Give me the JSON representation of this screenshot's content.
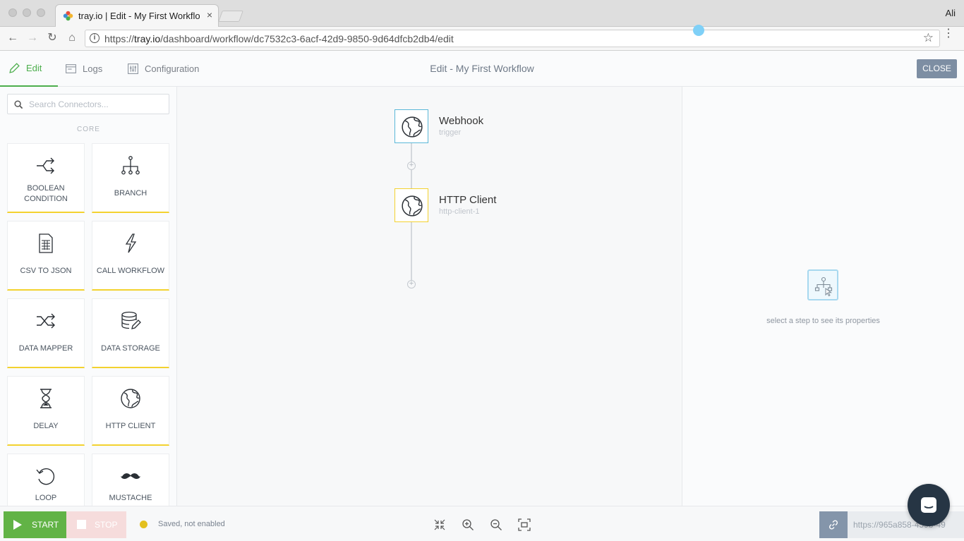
{
  "browser": {
    "tab_title": "tray.io | Edit - My First Workflo",
    "tab_close": "×",
    "profile_name": "Ali",
    "url_scheme": "https://",
    "url_host": "tray.io",
    "url_path": "/dashboard/workflow/dc7532c3-6acf-42d9-9850-9d64dfcb2db4/edit"
  },
  "header": {
    "tabs": [
      {
        "label": "Edit",
        "icon": "pencil-icon",
        "active": true
      },
      {
        "label": "Logs",
        "icon": "logs-icon",
        "active": false
      },
      {
        "label": "Configuration",
        "icon": "sliders-icon",
        "active": false
      }
    ],
    "title": "Edit - My First Workflow",
    "close_label": "CLOSE"
  },
  "sidebar": {
    "search_placeholder": "Search Connectors...",
    "section_label": "CORE",
    "connectors": [
      {
        "label": "BOOLEAN CONDITION",
        "icon": "boolean-condition-icon"
      },
      {
        "label": "BRANCH",
        "icon": "branch-icon"
      },
      {
        "label": "CSV TO JSON",
        "icon": "csv-document-icon"
      },
      {
        "label": "CALL WORKFLOW",
        "icon": "lightning-icon"
      },
      {
        "label": "DATA MAPPER",
        "icon": "shuffle-icon"
      },
      {
        "label": "DATA STORAGE",
        "icon": "database-icon"
      },
      {
        "label": "DELAY",
        "icon": "hourglass-icon"
      },
      {
        "label": "HTTP CLIENT",
        "icon": "globe-icon"
      },
      {
        "label": "LOOP",
        "icon": "loop-icon"
      },
      {
        "label": "MUSTACHE",
        "icon": "mustache-icon"
      }
    ]
  },
  "canvas": {
    "steps": [
      {
        "name": "Webhook",
        "sub": "trigger",
        "border_color": "#5bb8d8",
        "icon": "globe-icon"
      },
      {
        "name": "HTTP Client",
        "sub": "http-client-1",
        "border_color": "#f3d22f",
        "icon": "globe-icon"
      }
    ],
    "add_step_glyph": "+"
  },
  "properties": {
    "empty_text": "select a step to see its properties",
    "icon": "workflow-select-icon"
  },
  "footer": {
    "start_label": "START",
    "stop_label": "STOP",
    "status_text": "Saved, not enabled",
    "status_color": "#e3c01f",
    "webhook_url": "https://965a858-459b-49",
    "zoom_controls": [
      "fit-inward-icon",
      "zoom-in-icon",
      "zoom-out-icon",
      "fit-screen-icon"
    ]
  },
  "colors": {
    "accent_green": "#4cae4c",
    "start_green": "#62b346",
    "card_underline": "#f3d22f",
    "close_button": "#7d8ea3"
  }
}
